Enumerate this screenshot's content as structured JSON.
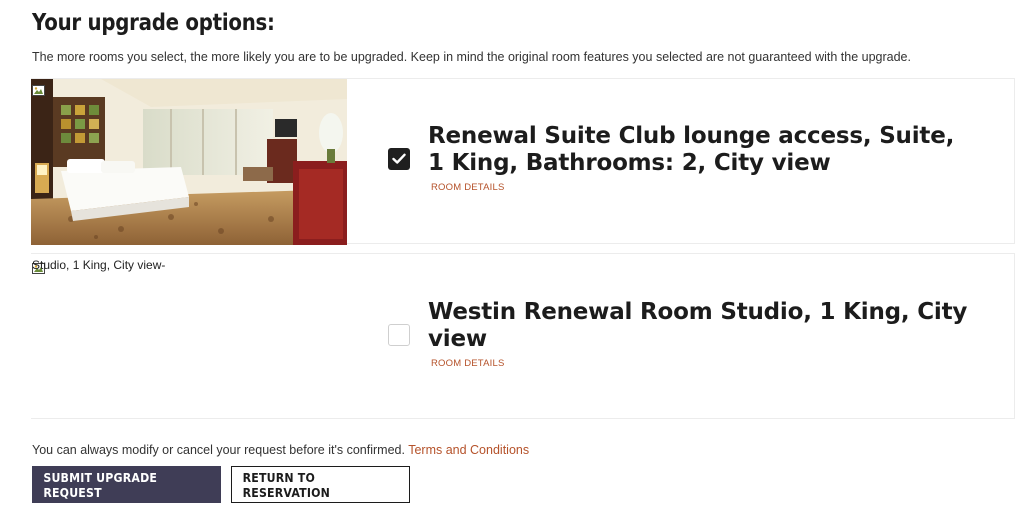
{
  "header": {
    "title": "Your upgrade options:",
    "subtitle": "The more rooms you select, the more likely you are to be upgraded. Keep in mind the original room features you selected are not guaranteed with the upgrade."
  },
  "rooms": [
    {
      "name": "Renewal Suite Club lounge access, Suite, 1 King, Bathrooms: 2, City view",
      "details_label": "ROOM DETAILS",
      "selected": true,
      "image": "hotel-suite-photo"
    },
    {
      "name": "Westin Renewal Room Studio, 1 King, City view",
      "details_label": "ROOM DETAILS",
      "selected": false,
      "image_alt": "Studio, 1 King, City view-"
    }
  ],
  "footer": {
    "note": "You can always modify or cancel your request before it's confirmed.",
    "terms_link": "Terms and Conditions",
    "submit_label": "SUBMIT UPGRADE REQUEST",
    "return_label": "RETURN TO RESERVATION"
  },
  "colors": {
    "accent_link": "#b5522a",
    "primary_button": "#3f3d56",
    "checkbox_checked": "#1f1f1f"
  }
}
